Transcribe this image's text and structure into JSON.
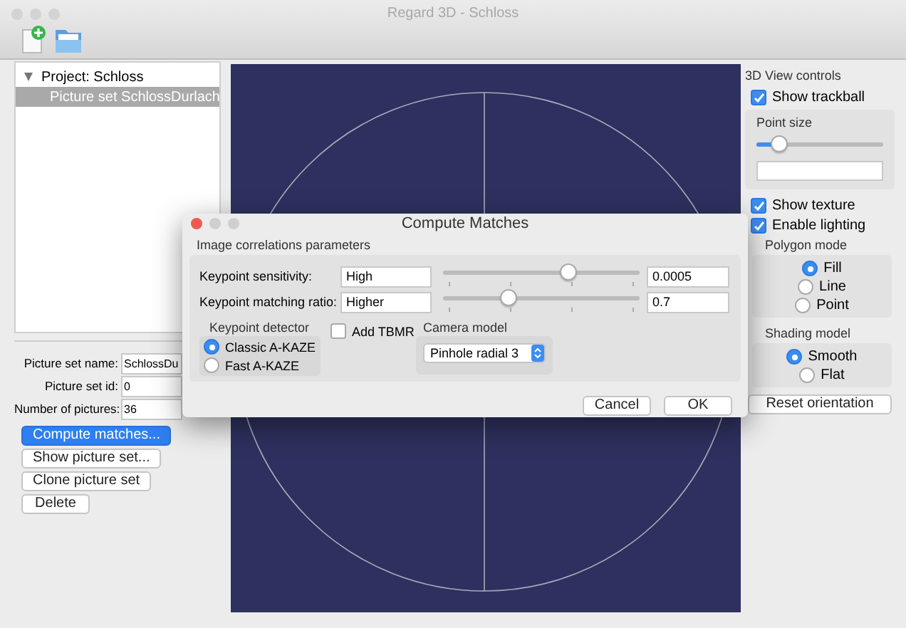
{
  "window": {
    "title": "Regard 3D - Schloss"
  },
  "tree": [
    {
      "label": "Project: Schloss",
      "expanded": true,
      "selected": false,
      "children": [
        {
          "label": "Picture set SchlossDurlach",
          "expanded": false,
          "selected": true
        }
      ]
    }
  ],
  "properties": [
    {
      "label": "Picture set name:",
      "value": "SchlossDu"
    },
    {
      "label": "Picture set id:",
      "value": "0"
    },
    {
      "label": "Number of pictures:",
      "value": "36"
    }
  ],
  "actions": [
    {
      "label": "Compute matches...",
      "default": true
    },
    {
      "label": "Show picture set...",
      "default": false
    },
    {
      "label": "Clone picture set",
      "default": false
    },
    {
      "label": "Delete",
      "default": false
    }
  ],
  "view_controls": {
    "title": "3D View controls",
    "show_trackball": {
      "label": "Show trackball",
      "checked": true
    },
    "point_size": {
      "title": "Point size",
      "level": 0.18
    },
    "show_texture": {
      "label": "Show texture",
      "checked": true
    },
    "enable_lighting": {
      "label": "Enable lighting",
      "checked": true
    },
    "polygon_mode": {
      "title": "Polygon mode",
      "options": [
        {
          "label": "Fill",
          "selected": true
        },
        {
          "label": "Line",
          "selected": false
        },
        {
          "label": "Point",
          "selected": false
        }
      ]
    },
    "shading_model": {
      "title": "Shading model",
      "options": [
        {
          "label": "Smooth",
          "selected": true
        },
        {
          "label": "Flat",
          "selected": false
        }
      ]
    },
    "reset_button": "Reset orientation"
  },
  "dialog": {
    "title": "Compute Matches",
    "group_title": "Image correlations parameters",
    "params": [
      {
        "label": "Keypoint sensitivity:",
        "value": "High",
        "level": 0.64,
        "reading": "0.0005"
      },
      {
        "label": "Keypoint matching ratio:",
        "value": "Higher",
        "level": 0.33,
        "reading": "0.7"
      }
    ],
    "detector": {
      "title": "Keypoint detector",
      "options": [
        {
          "label": "Classic A-KAZE",
          "selected": true
        },
        {
          "label": "Fast A-KAZE",
          "selected": false
        }
      ]
    },
    "add_tbmr": {
      "label": "Add TBMR",
      "checked": false
    },
    "camera_model": {
      "title": "Camera model",
      "value": "Pinhole radial 3"
    },
    "buttons": [
      {
        "label": "Cancel",
        "default": false
      },
      {
        "label": "OK",
        "default": false
      }
    ]
  }
}
